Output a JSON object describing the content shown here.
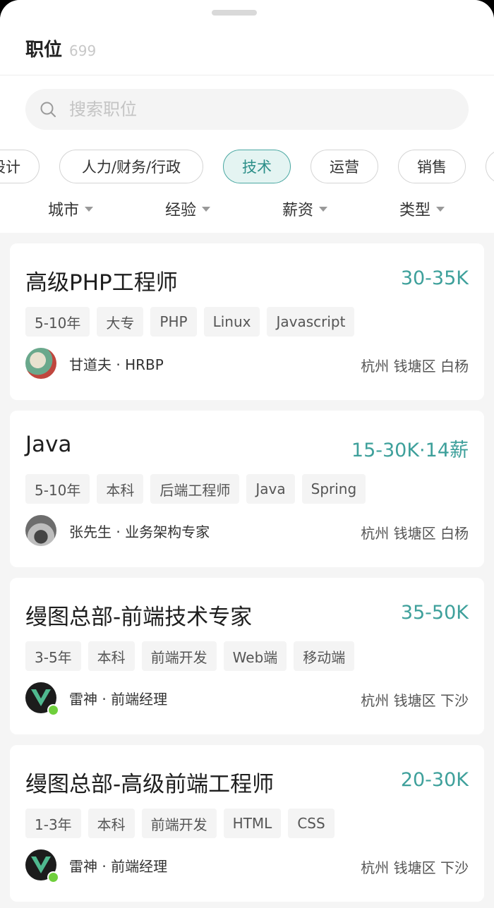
{
  "header": {
    "title": "职位",
    "count": "699"
  },
  "search": {
    "placeholder": "搜索职位",
    "value": ""
  },
  "categories": [
    "设计",
    "人力/财务/行政",
    "技术",
    "运营",
    "销售",
    ""
  ],
  "active_category": "技术",
  "filters": [
    "城市",
    "经验",
    "薪资",
    "类型"
  ],
  "jobs": [
    {
      "title": "高级PHP工程师",
      "salary": "30-35K",
      "tags": [
        "5-10年",
        "大专",
        "PHP",
        "Linux",
        "Javascript"
      ],
      "recruiter": "甘道夫 · HRBP",
      "location": "杭州 钱塘区 白杨"
    },
    {
      "title": "Java",
      "salary": "15-30K·14薪",
      "tags": [
        "5-10年",
        "本科",
        "后端工程师",
        "Java",
        "Spring"
      ],
      "recruiter": "张先生 · 业务架构专家",
      "location": "杭州 钱塘区 白杨"
    },
    {
      "title": "缦图总部-前端技术专家",
      "salary": "35-50K",
      "tags": [
        "3-5年",
        "本科",
        "前端开发",
        "Web端",
        "移动端"
      ],
      "recruiter": "雷神 · 前端经理",
      "location": "杭州 钱塘区 下沙"
    },
    {
      "title": "缦图总部-高级前端工程师",
      "salary": "20-30K",
      "tags": [
        "1-3年",
        "本科",
        "前端开发",
        "HTML",
        "CSS"
      ],
      "recruiter": "雷神 · 前端经理",
      "location": "杭州 钱塘区 下沙"
    }
  ],
  "colors": {
    "accent": "#3ea09b",
    "active_chip_bg": "#e4f4f2",
    "online": "#6fcf3c"
  }
}
